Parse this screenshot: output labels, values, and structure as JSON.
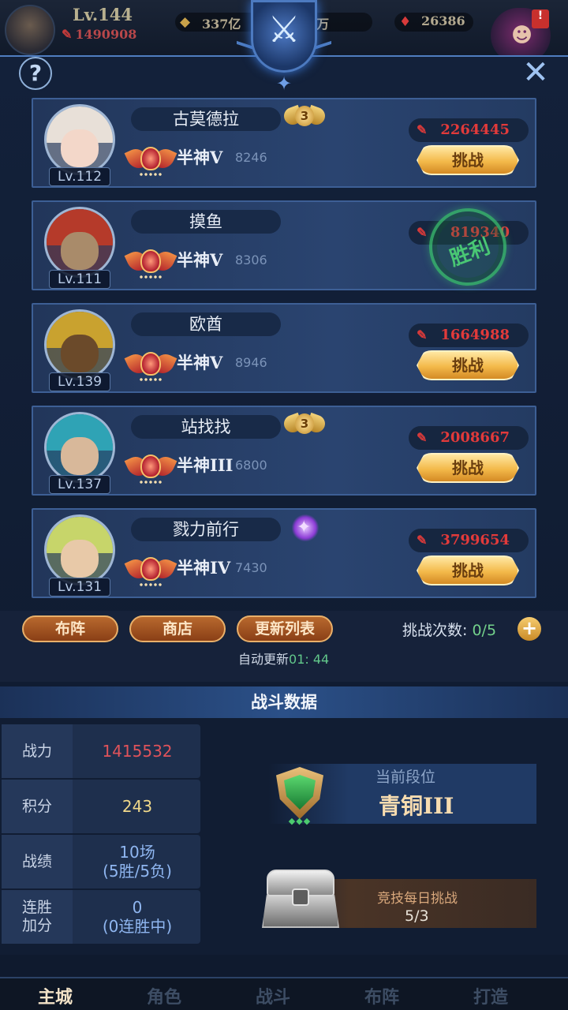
{
  "hud": {
    "level": "Lv.144",
    "power": "1490908",
    "gold": "337亿",
    "diamonds": "7万",
    "gems": "26386",
    "notice_badge": "!"
  },
  "opponents": [
    {
      "name": "古莫德拉",
      "level": "Lv.112",
      "rank": "半神V",
      "score": "8246",
      "power": "2264445",
      "action": "挑战",
      "medal": "3",
      "medal_type": "gold",
      "avatar_colors": [
        "#e8e0d8",
        "#f3d7c9"
      ]
    },
    {
      "name": "摸鱼",
      "level": "Lv.111",
      "rank": "半神V",
      "score": "8306",
      "power": "819340",
      "action": "",
      "status": "胜利",
      "medal": "",
      "medal_type": "none",
      "avatar_colors": [
        "#b53a2a",
        "#a98b6a"
      ]
    },
    {
      "name": "欧酋",
      "level": "Lv.139",
      "rank": "半神V",
      "score": "8946",
      "power": "1664988",
      "action": "挑战",
      "medal": "",
      "medal_type": "none",
      "avatar_colors": [
        "#c9a22f",
        "#6b4a2a"
      ]
    },
    {
      "name": "站找找",
      "level": "Lv.137",
      "rank": "半神III",
      "score": "6800",
      "power": "2008667",
      "action": "挑战",
      "medal": "3",
      "medal_type": "gold",
      "avatar_colors": [
        "#2fa3b5",
        "#d8b89a"
      ]
    },
    {
      "name": "戮力前行",
      "level": "Lv.131",
      "rank": "半神IV",
      "score": "7430",
      "power": "3799654",
      "action": "挑战",
      "medal": "",
      "medal_type": "purple",
      "avatar_colors": [
        "#c7d56a",
        "#e8c9a8"
      ]
    }
  ],
  "actions": {
    "lineup": "布阵",
    "shop": "商店",
    "refresh": "更新列表",
    "challenge_label": "挑战次数:",
    "challenge_value": "0/5",
    "plus": "+",
    "auto_label": "自动更新",
    "auto_time": "01: 44"
  },
  "battle": {
    "title": "战斗数据",
    "stats": [
      {
        "key": "战力",
        "value": "1415532",
        "color": "#e0535a"
      },
      {
        "key": "积分",
        "value": "243",
        "color": "#f0d88a"
      },
      {
        "key": "战绩",
        "value": "10场",
        "sub": "(5胜/5负)",
        "color": "#8fb6f0"
      },
      {
        "key": "连胜\n加分",
        "value": "0",
        "sub": "(0连胜中)",
        "color": "#8fb6f0"
      }
    ],
    "current_rank_label": "当前段位",
    "current_rank": "青铜III",
    "daily_label": "竞技每日挑战",
    "daily_value": "5/3"
  },
  "nav": [
    {
      "label": "主城",
      "active": true
    },
    {
      "label": "角色",
      "active": false
    },
    {
      "label": "战斗",
      "active": false
    },
    {
      "label": "布阵",
      "active": false
    },
    {
      "label": "打造",
      "active": false
    }
  ]
}
